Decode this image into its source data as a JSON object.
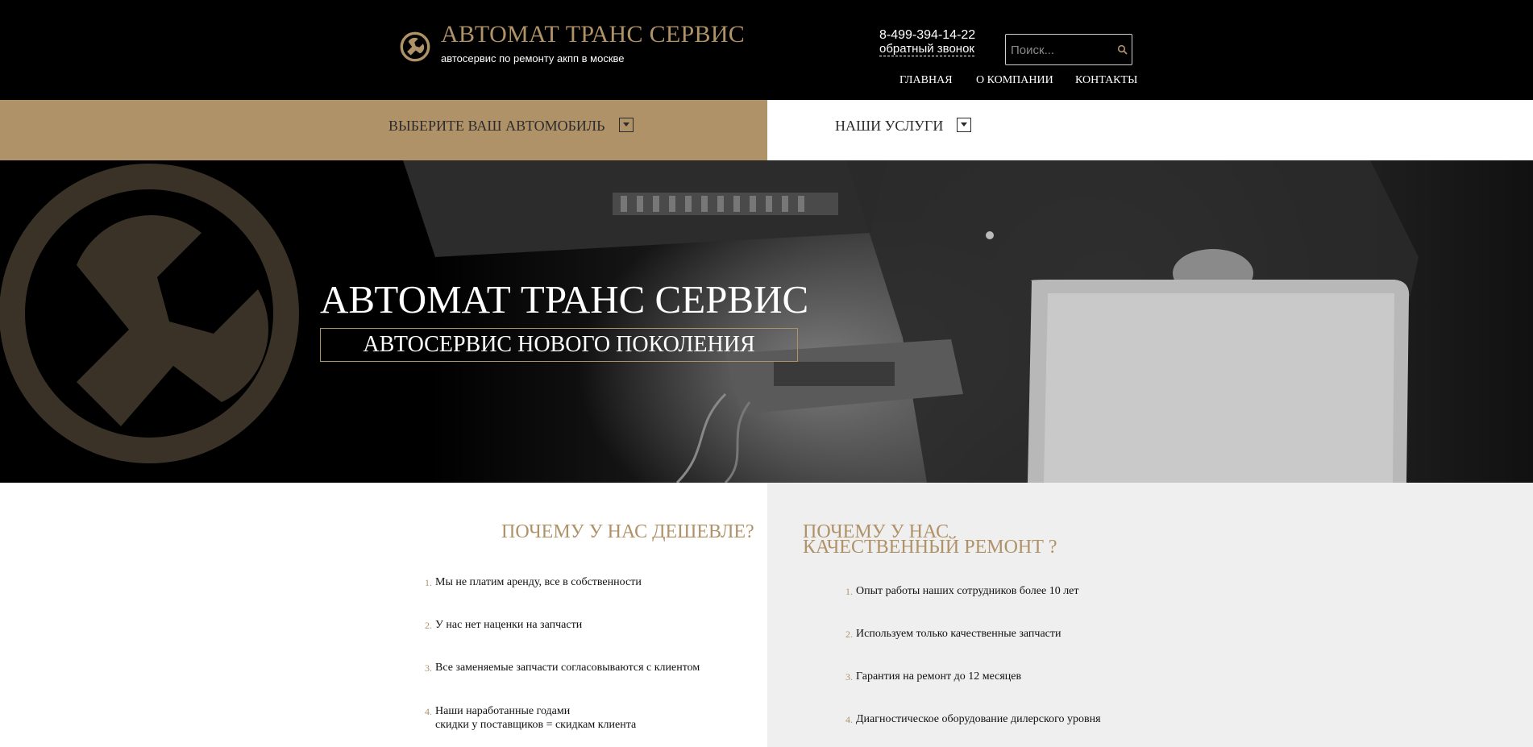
{
  "header": {
    "logo_title": "АВТОМАТ ТРАНС СЕРВИС",
    "logo_subtitle": "автосервис по ремонту акпп в москве",
    "phone": "8-499-394-14-22",
    "callback_label": "обратный звонок",
    "search_placeholder": "Поиск...",
    "nav": [
      "ГЛАВНАЯ",
      "О КОМПАНИИ",
      "КОНТАКТЫ"
    ]
  },
  "selector_bar": {
    "car_label": "ВЫБЕРИТЕ ВАШ АВТОМОБИЛЬ",
    "services_label": "НАШИ УСЛУГИ"
  },
  "hero": {
    "title": "АВТОМАТ ТРАНС СЕРВИС",
    "subtitle": "АВТОСЕРВИС НОВОГО ПОКОЛЕНИЯ"
  },
  "cheaper": {
    "title": "ПОЧЕМУ У НАС ДЕШЕВЛЕ?",
    "items": [
      "Мы не платим аренду, все в собственности",
      "У нас нет наценки на запчасти",
      "Все заменяемые запчасти согласовываются с клиентом",
      "Наши наработанные годами",
      "скидки у поставщиков = скидкам клиента"
    ],
    "numbers": [
      "1.",
      "2.",
      "3.",
      "4."
    ]
  },
  "quality": {
    "title_line1": "ПОЧЕМУ У НАС",
    "title_line2": "КАЧЕСТВЕННЫЙ РЕМОНТ ?",
    "items": [
      "Опыт работы наших сотрудников более 10 лет",
      "Используем только качественные запчасти",
      "Гарантия на ремонт до 12 месяцев",
      "Диагностическое оборудование дилерского уровня"
    ],
    "numbers": [
      "1.",
      "2.",
      "3.",
      "4."
    ]
  },
  "colors": {
    "accent_gold": "#b09268",
    "header_bg": "#000000",
    "panel_gray": "#efefef"
  },
  "icons": [
    "wrench-logo-icon",
    "search-icon",
    "dropdown-icon",
    "wrench-watermark-icon"
  ]
}
